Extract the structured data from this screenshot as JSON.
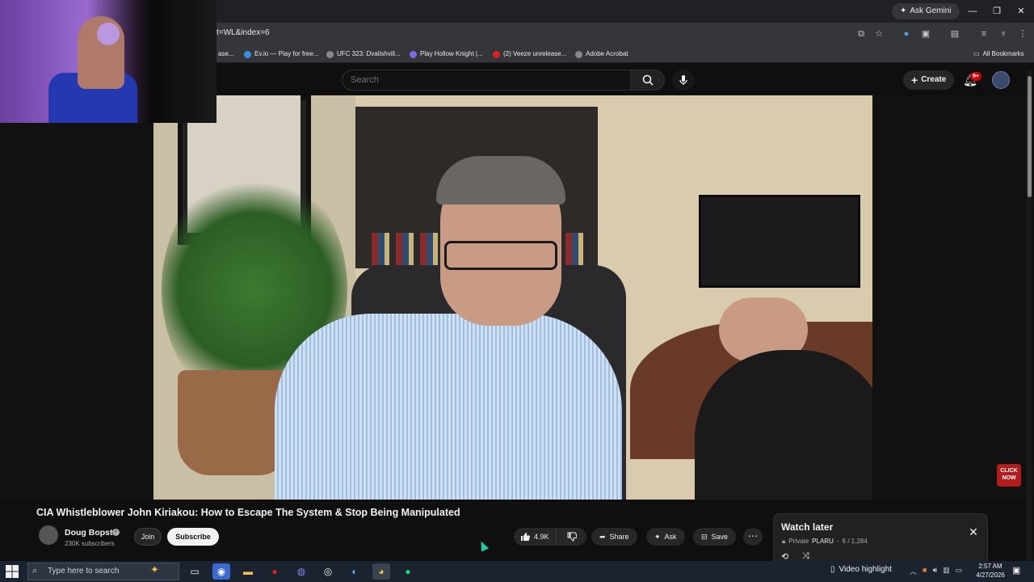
{
  "browser": {
    "ask_gemini": "Ask Gemini",
    "url": "t=WL&index=6",
    "bookmarks": [
      {
        "label": "ase...",
        "color": "#777777"
      },
      {
        "label": "Ev.io — Play for free...",
        "color": "#3a8ee6"
      },
      {
        "label": "UFC 323: Dvalishvili...",
        "color": "#888888"
      },
      {
        "label": "Play Hollow Knight |...",
        "color": "#7a6ae0"
      },
      {
        "label": "(2) Veeze unrelease...",
        "color": "#e02020"
      },
      {
        "label": "Adobe Acrobat",
        "color": "#888888"
      }
    ],
    "all_bookmarks": "All Bookmarks"
  },
  "youtube": {
    "search_placeholder": "Search",
    "create_label": "Create",
    "notification_count": "9+"
  },
  "video": {
    "title": "CIA Whistleblower John Kiriakou: How to Escape The System & Stop Being Manipulated",
    "channel": "Doug Bopst",
    "subscribers": "230K subscribers",
    "join_label": "Join",
    "subscribe_label": "Subscribe",
    "likes": "4.9K",
    "share_label": "Share",
    "ask_label": "Ask",
    "save_label": "Save",
    "ad_badge": "CLICK NOW"
  },
  "watch_later": {
    "title": "Watch later",
    "privacy": "Private",
    "owner": "PLARU",
    "position": "6 / 1,284"
  },
  "taskbar": {
    "search_placeholder": "Type here to search",
    "video_highlight": "Video highlight",
    "time": "2:57 AM",
    "date": "4/27/2026"
  }
}
